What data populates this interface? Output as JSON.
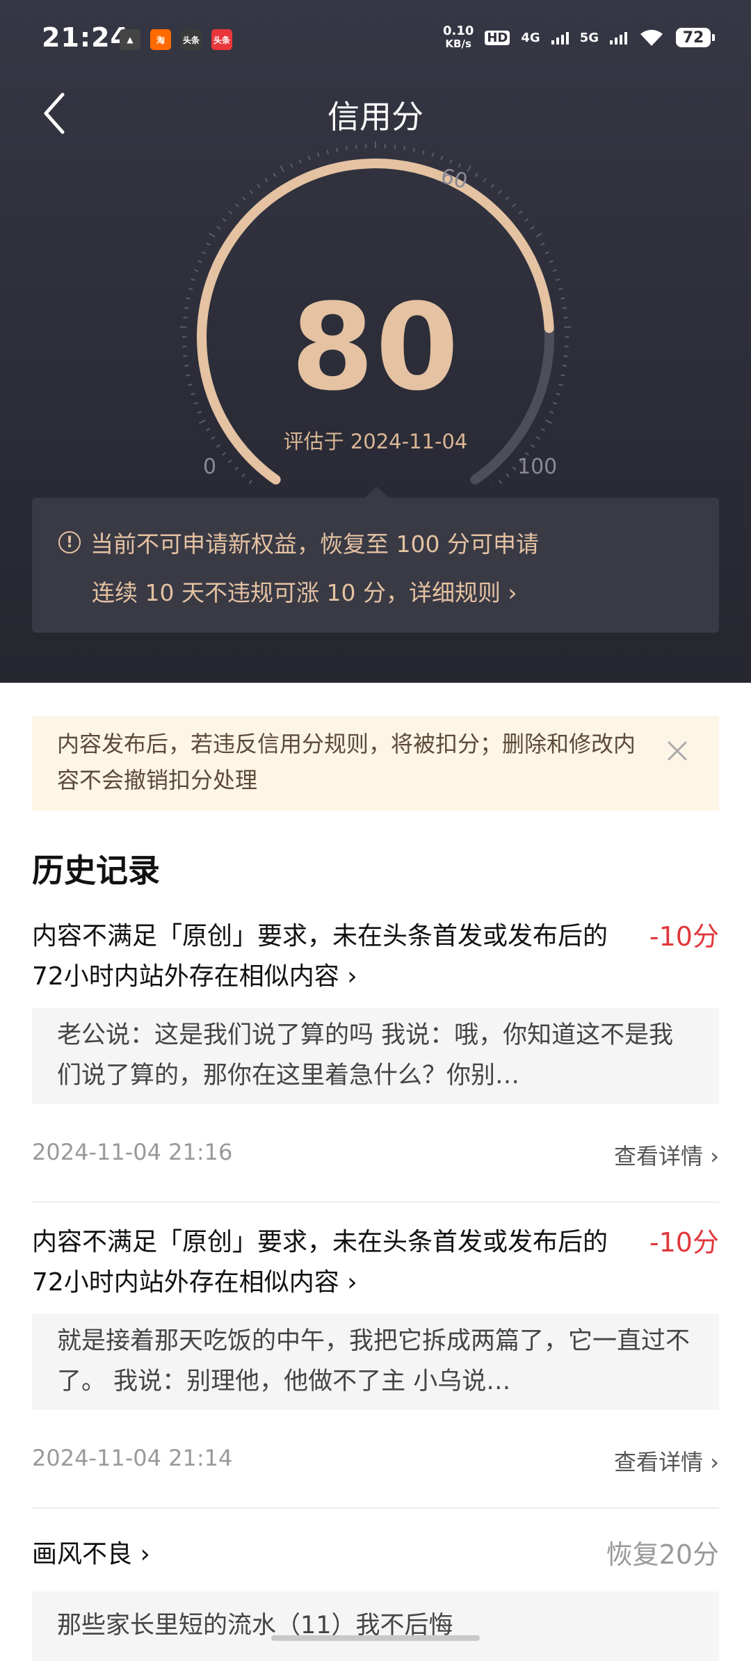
{
  "status_bar": {
    "time": "21:24",
    "apps": [
      {
        "name": "gallery-icon",
        "text": "▲",
        "color": "#444"
      },
      {
        "name": "taobao-icon",
        "text": "淘",
        "color": "#ff6a00"
      },
      {
        "name": "toutiao-icon",
        "text": "头条",
        "color": "#3b3b3b"
      },
      {
        "name": "toutiao-red-icon",
        "text": "头条",
        "color": "#e8363b"
      }
    ],
    "net_speed_value": "0.10",
    "net_speed_unit": "KB/s",
    "hd": "HD",
    "sig1": "4G",
    "sig2": "5G",
    "battery": "72"
  },
  "header": {
    "title": "信用分"
  },
  "gauge": {
    "score": "80",
    "date_text": "评估于 2024-11-04",
    "min_label": "0",
    "mid_label": "60",
    "max_label": "100",
    "fill_fraction": 0.8,
    "accent_color": "#e4c2a2",
    "track_color": "#4e4e5a"
  },
  "info": {
    "line1": "当前不可申请新权益，恢复至 100 分可申请",
    "line2": "连续 10 天不违规可涨 10 分，详细规则 ›"
  },
  "notice": {
    "text": "内容发布后，若违反信用分规则，将被扣分；删除和修改内容不会撤销扣分处理"
  },
  "history": {
    "title": "历史记录",
    "detail_label": "查看详情",
    "records": [
      {
        "title": "内容不满足「原创」要求，未在头条首发或发布后的72小时内站外存在相似内容 ›",
        "score": "-10分",
        "quote": "老公说：这是我们说了算的吗 我说：哦，你知道这不是我们说了算的，那你在这里着急什么？你别…",
        "time": "2024-11-04 21:16"
      },
      {
        "title": "内容不满足「原创」要求，未在头条首发或发布后的72小时内站外存在相似内容 ›",
        "score": "-10分",
        "quote": "就是接着那天吃饭的中午，我把它拆成两篇了，它一直过不了。 我说：别理他，他做不了主 小乌说…",
        "time": "2024-11-04 21:14"
      },
      {
        "title": "画风不良 ›",
        "score": "恢复20分",
        "quote": "那些家长里短的流水（11）我不后悔"
      }
    ]
  }
}
